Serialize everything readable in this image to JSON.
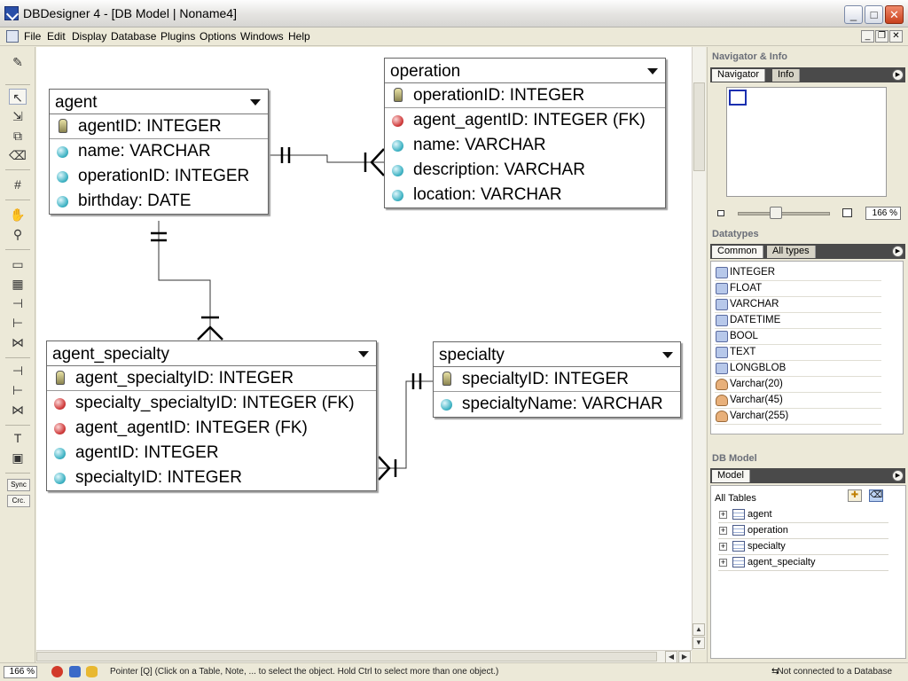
{
  "window": {
    "title": "DBDesigner 4 - [DB Model | Noname4]",
    "minimize": "_",
    "maximize": "□",
    "close": "✕"
  },
  "menu": {
    "items": [
      "File",
      "Edit",
      "Display",
      "Database",
      "Plugins",
      "Options",
      "Windows",
      "Help"
    ]
  },
  "toolbar": {
    "sync_label": "Sync",
    "crc_label": "Crc."
  },
  "canvas": {
    "tables": {
      "agent": {
        "name": "agent",
        "columns": [
          {
            "text": "agentID: INTEGER",
            "kind": "key-icon"
          },
          {
            "text": "name: VARCHAR",
            "kind": "attribute-icon"
          },
          {
            "text": "operationID: INTEGER",
            "kind": "attribute-icon"
          },
          {
            "text": "birthday: DATE",
            "kind": "attribute-icon"
          }
        ]
      },
      "operation": {
        "name": "operation",
        "columns": [
          {
            "text": "operationID: INTEGER",
            "kind": "key-icon"
          },
          {
            "text": "agent_agentID: INTEGER (FK)",
            "kind": "foreign-key-icon"
          },
          {
            "text": "name: VARCHAR",
            "kind": "attribute-icon"
          },
          {
            "text": "description: VARCHAR",
            "kind": "attribute-icon"
          },
          {
            "text": "location: VARCHAR",
            "kind": "attribute-icon"
          }
        ]
      },
      "agent_specialty": {
        "name": "agent_specialty",
        "columns": [
          {
            "text": "agent_specialtyID: INTEGER",
            "kind": "key-icon"
          },
          {
            "text": "specialty_specialtyID: INTEGER (FK)",
            "kind": "foreign-key-icon"
          },
          {
            "text": "agent_agentID: INTEGER (FK)",
            "kind": "foreign-key-icon"
          },
          {
            "text": "agentID: INTEGER",
            "kind": "attribute-icon"
          },
          {
            "text": "specialtyID: INTEGER",
            "kind": "attribute-icon"
          }
        ]
      },
      "specialty": {
        "name": "specialty",
        "columns": [
          {
            "text": "specialtyID: INTEGER",
            "kind": "key-icon"
          },
          {
            "text": "specialtyName: VARCHAR",
            "kind": "attribute-icon"
          }
        ]
      }
    }
  },
  "navigator": {
    "title": "Navigator & Info",
    "tabs": [
      "Navigator",
      "Info"
    ],
    "zoom": "166 %"
  },
  "datatypes": {
    "title": "Datatypes",
    "tabs": [
      "Common",
      "All types"
    ],
    "items": [
      "INTEGER",
      "FLOAT",
      "VARCHAR",
      "DATETIME",
      "BOOL",
      "TEXT",
      "LONGBLOB",
      "Varchar(20)",
      "Varchar(45)",
      "Varchar(255)"
    ]
  },
  "dbmodel": {
    "title": "DB Model",
    "tab": "Model",
    "all_tables": "All Tables",
    "tables": [
      "agent",
      "operation",
      "specialty",
      "agent_specialty"
    ]
  },
  "status": {
    "zoom": "166 %",
    "message": "Pointer [Q] (Click on a Table, Note, ... to select the object. Hold Ctrl to select more than one object.)",
    "connection": "Not connected to a Database"
  }
}
